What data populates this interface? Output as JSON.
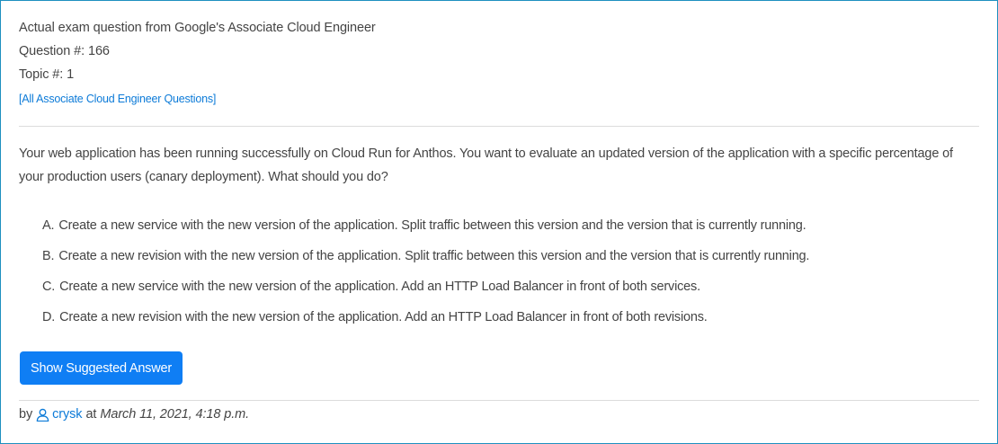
{
  "header": {
    "line1": "Actual exam question from Google's Associate Cloud Engineer",
    "line2": "Question #: 166",
    "line3": "Topic #: 1",
    "all_questions_link": "[All Associate Cloud Engineer Questions]"
  },
  "question": {
    "text": "Your web application has been running successfully on Cloud Run for Anthos. You want to evaluate an updated version of the application with a specific percentage of your production users (canary deployment). What should you do?"
  },
  "choices": [
    {
      "letter": "A.",
      "text": "Create a new service with the new version of the application. Split traffic between this version and the version that is currently running."
    },
    {
      "letter": "B.",
      "text": "Create a new revision with the new version of the application. Split traffic between this version and the version that is currently running."
    },
    {
      "letter": "C.",
      "text": "Create a new service with the new version of the application. Add an HTTP Load Balancer in front of both services."
    },
    {
      "letter": "D.",
      "text": "Create a new revision with the new version of the application. Add an HTTP Load Balancer in front of both revisions."
    }
  ],
  "actions": {
    "show_answer_label": "Show Suggested Answer"
  },
  "byline": {
    "prefix": "by",
    "username": "crysk",
    "at": "at",
    "date": "March 11, 2021, 4:18 p.m."
  },
  "colors": {
    "accent": "#0f7ef4",
    "link": "#0d7bd8",
    "border": "#1e8fc0"
  },
  "icons": {
    "user": "user-icon"
  }
}
